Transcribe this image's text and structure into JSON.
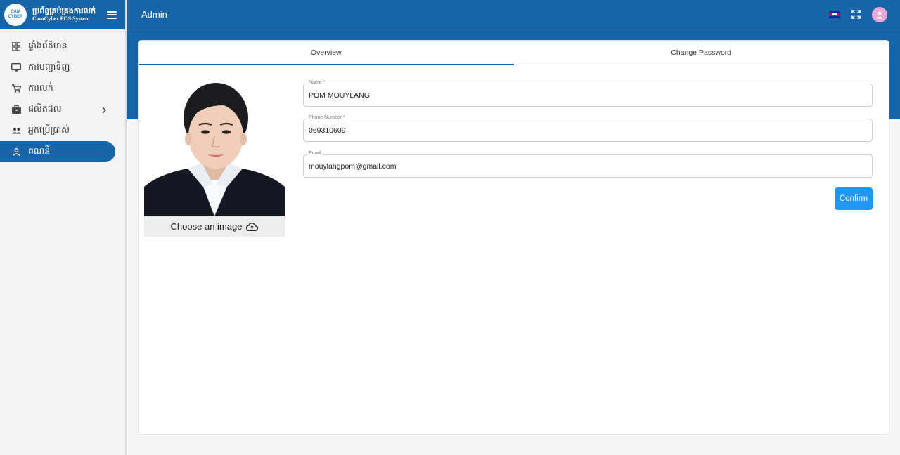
{
  "brand": {
    "logo_text_top": "CAM",
    "logo_text_bottom": "CYBER",
    "title": "ប្រព័ន្ធគ្រប់គ្រងការលក់",
    "subtitle": "CamCyber POS System"
  },
  "header": {
    "title": "Admin",
    "language_icon": "cambodia-flag-icon",
    "fullscreen_icon": "fullscreen-icon",
    "avatar_icon": "user-avatar-icon"
  },
  "sidebar": {
    "items": [
      {
        "label": "ផ្ទាំងព័ត៌មាន",
        "icon": "dashboard-icon",
        "active": false
      },
      {
        "label": "ការបញ្ជាទិញ",
        "icon": "monitor-icon",
        "active": false
      },
      {
        "label": "ការលក់",
        "icon": "cart-icon",
        "active": false
      },
      {
        "label": "ផលិតផល",
        "icon": "briefcase-icon",
        "active": false,
        "has_submenu": true
      },
      {
        "label": "អ្នកប្រើប្រាស់",
        "icon": "users-icon",
        "active": false
      },
      {
        "label": "គណនី",
        "icon": "person-icon",
        "active": true
      }
    ]
  },
  "tabs": [
    {
      "label": "Overview",
      "active": true
    },
    {
      "label": "Change Password",
      "active": false
    }
  ],
  "profile": {
    "choose_image_label": "Choose an image",
    "upload_icon": "cloud-upload-icon"
  },
  "form": {
    "name": {
      "label": "Name *",
      "value": "POM MOUYLANG"
    },
    "phone": {
      "label": "Phone Number *",
      "value": "069310609"
    },
    "email": {
      "label": "Email",
      "value": "mouylangpom@gmail.com"
    },
    "confirm_label": "Confirm"
  },
  "colors": {
    "primary": "#1565a8",
    "confirm_button": "#2196f3",
    "sidebar_bg": "#f3f3f3"
  }
}
